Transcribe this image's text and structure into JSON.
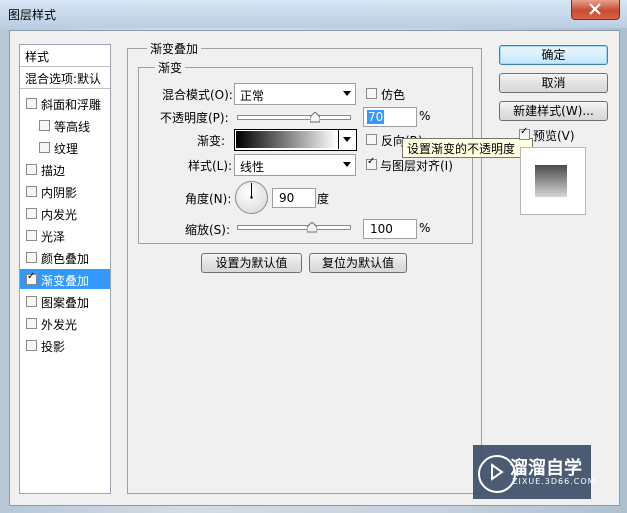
{
  "window": {
    "title": "图层样式"
  },
  "style_list": {
    "header": "样式",
    "blend_options": "混合选项:默认",
    "items": [
      {
        "label": "斜面和浮雕",
        "checked": false,
        "active": false
      },
      {
        "label": "等高线",
        "checked": false,
        "active": false,
        "sub": true
      },
      {
        "label": "纹理",
        "checked": false,
        "active": false,
        "sub": true
      },
      {
        "label": "描边",
        "checked": false,
        "active": false
      },
      {
        "label": "内阴影",
        "checked": false,
        "active": false
      },
      {
        "label": "内发光",
        "checked": false,
        "active": false
      },
      {
        "label": "光泽",
        "checked": false,
        "active": false
      },
      {
        "label": "颜色叠加",
        "checked": false,
        "active": false
      },
      {
        "label": "渐变叠加",
        "checked": true,
        "active": true
      },
      {
        "label": "图案叠加",
        "checked": false,
        "active": false
      },
      {
        "label": "外发光",
        "checked": false,
        "active": false
      },
      {
        "label": "投影",
        "checked": false,
        "active": false
      }
    ]
  },
  "panel": {
    "outer_title": "渐变叠加",
    "inner_title": "渐变",
    "blend_mode": {
      "label": "混合模式(O):",
      "value": "正常"
    },
    "dither": {
      "label": "仿色",
      "checked": false
    },
    "opacity": {
      "label": "不透明度(P):",
      "value": "70",
      "unit": "%",
      "level": 0.7
    },
    "gradient": {
      "label": "渐变:"
    },
    "reverse": {
      "label": "反向(R)",
      "checked": false
    },
    "tooltip": "设置渐变的不透明度",
    "style": {
      "label": "样式(L):",
      "value": "线性"
    },
    "align": {
      "label": "与图层对齐(I)",
      "checked": true
    },
    "angle": {
      "label": "角度(N):",
      "value": "90",
      "unit": "度"
    },
    "scale": {
      "label": "缩放(S):",
      "value": "100",
      "unit": "%",
      "level": 0.67
    },
    "set_default": "设置为默认值",
    "reset_default": "复位为默认值"
  },
  "buttons": {
    "ok": "确定",
    "cancel": "取消",
    "new_style": "新建样式(W)...",
    "preview": {
      "label": "预览(V)",
      "checked": true
    }
  },
  "watermark": {
    "title": "溜溜自学",
    "sub": "ZIXUE.3D66.COM"
  },
  "colors": {
    "accent_selection": "#3399ff",
    "tooltip_bg": "#ffffe1"
  }
}
